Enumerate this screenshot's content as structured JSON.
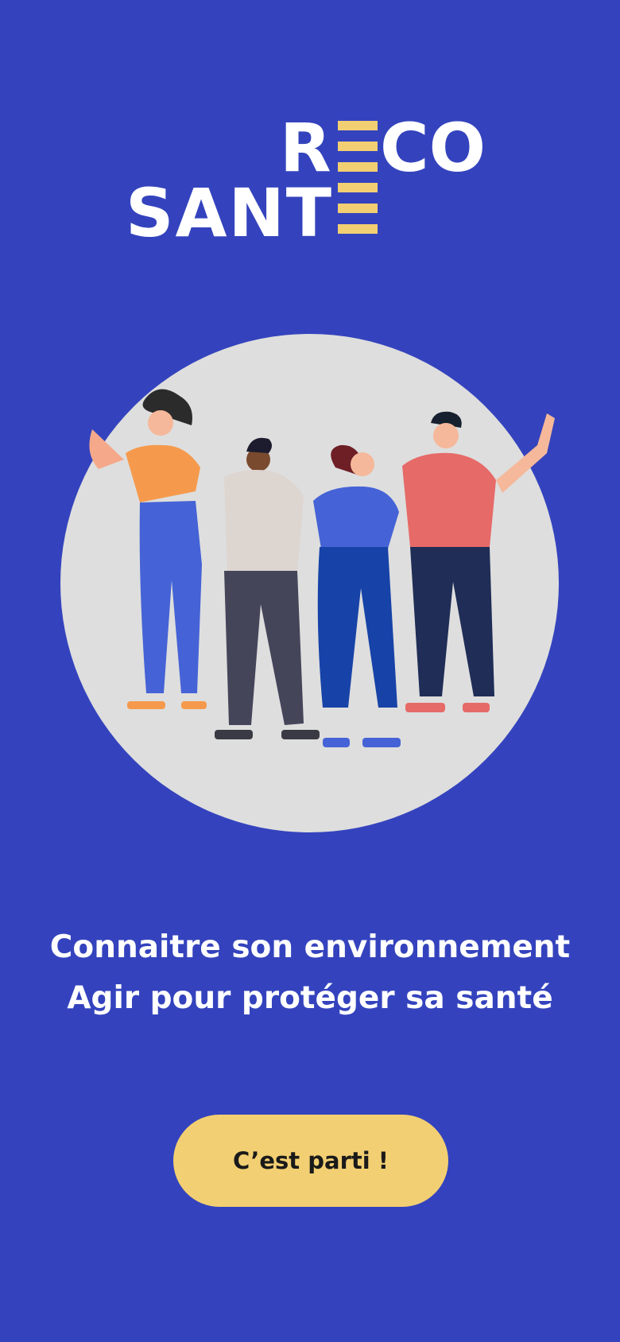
{
  "app": {
    "logo_line1": "RECO",
    "logo_line2": "SANTE",
    "logo_text_r": "R",
    "logo_text_co": "CO",
    "logo_text_sant": "SANT"
  },
  "colors": {
    "background": "#3443bd",
    "accent": "#f2cf72",
    "illustration_circle": "#dedede",
    "text": "#ffffff"
  },
  "illustration": {
    "icon": "group-of-people-illustration"
  },
  "tagline": {
    "line1": "Connaitre son environnement",
    "line2": "Agir pour protéger sa santé"
  },
  "cta": {
    "label": "C’est parti !"
  }
}
